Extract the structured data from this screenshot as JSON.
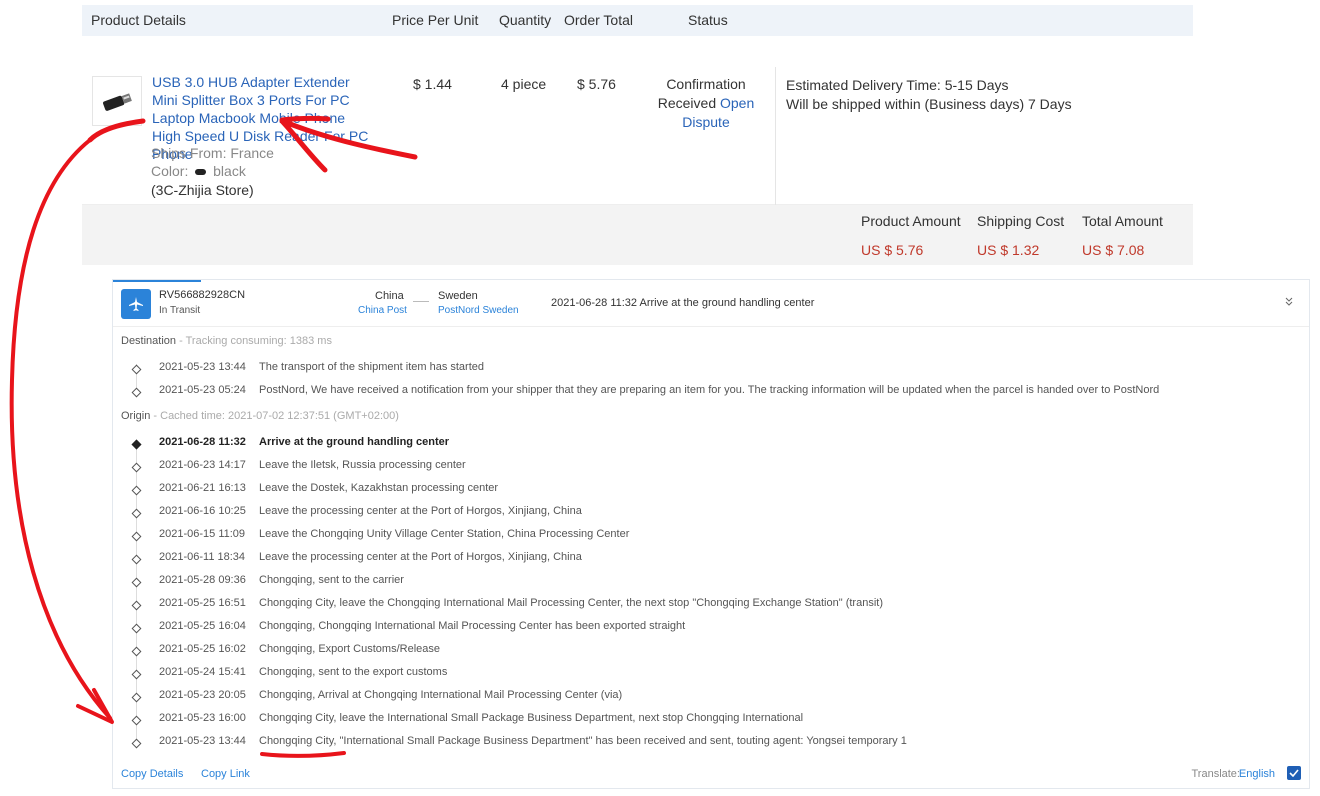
{
  "order": {
    "headers": {
      "product": "Product Details",
      "price": "Price Per Unit",
      "quantity": "Quantity",
      "total": "Order Total",
      "status": "Status"
    },
    "product": {
      "title": "USB 3.0 HUB Adapter Extender Mini Splitter Box 3 Ports For PC Laptop Macbook Mobile Phone High Speed U Disk Reader For PC Phone",
      "ships_from": "Ships From: France",
      "color_label": "Color:",
      "color_value": "black",
      "store": "(3C-Zhijia Store)",
      "icons": [
        "delivery-truck-icon",
        "card-icon"
      ]
    },
    "price": "$ 1.44",
    "quantity": "4 piece",
    "order_total": "$ 5.76",
    "status": {
      "text": "Confirmation Received",
      "link_open": "Open",
      "link_dispute": "Dispute"
    },
    "delivery": {
      "estimated": "Estimated Delivery Time:  5-15 Days",
      "ship_within": "Will be shipped within (Business days)  7 Days"
    },
    "totals": {
      "product_amount_label": "Product Amount",
      "product_amount": "US $ 5.76",
      "shipping_cost_label": "Shipping Cost",
      "shipping_cost": "US $ 1.32",
      "total_amount_label": "Total Amount",
      "total_amount": "US $ 7.08"
    }
  },
  "tracking": {
    "number": "RV566882928CN",
    "state": "In Transit",
    "origin_country": "China",
    "origin_carrier": "China Post",
    "dest_country": "Sweden",
    "dest_carrier": "PostNord Sweden",
    "latest": "2021-06-28 11:32  Arrive at the ground handling center",
    "collapse_icon": "collapse-chevrons-icon",
    "destination": {
      "label": "Destination",
      "note": " - Tracking consuming: 1383 ms",
      "events": [
        {
          "time": "2021-05-23 13:44",
          "desc": "The transport of the shipment item has started"
        },
        {
          "time": "2021-05-23 05:24",
          "desc": "PostNord, We have received a notification from your shipper that they are preparing an item for you. The tracking information will be updated when the parcel is handed over to PostNord"
        }
      ]
    },
    "origin": {
      "label": "Origin",
      "note": " - Cached time: 2021-07-02 12:37:51 (GMT+02:00)",
      "events": [
        {
          "time": "2021-06-28 11:32",
          "desc": "Arrive at the ground handling center"
        },
        {
          "time": "2021-06-23 14:17",
          "desc": "Leave the Iletsk, Russia processing center"
        },
        {
          "time": "2021-06-21 16:13",
          "desc": "Leave the Dostek, Kazakhstan processing center"
        },
        {
          "time": "2021-06-16 10:25",
          "desc": "Leave the processing center at the Port of Horgos, Xinjiang, China"
        },
        {
          "time": "2021-06-15 11:09",
          "desc": "Leave the Chongqing Unity Village Center Station, China Processing Center"
        },
        {
          "time": "2021-06-11 18:34",
          "desc": "Leave the processing center at the Port of Horgos, Xinjiang, China"
        },
        {
          "time": "2021-05-28 09:36",
          "desc": "Chongqing, sent to the carrier"
        },
        {
          "time": "2021-05-25 16:51",
          "desc": "Chongqing City, leave the Chongqing International Mail Processing Center, the next stop \"Chongqing Exchange Station\" (transit)"
        },
        {
          "time": "2021-05-25 16:04",
          "desc": "Chongqing, Chongqing International Mail Processing Center has been exported straight"
        },
        {
          "time": "2021-05-25 16:02",
          "desc": "Chongqing, Export Customs/Release"
        },
        {
          "time": "2021-05-24 15:41",
          "desc": "Chongqing, sent to the export customs"
        },
        {
          "time": "2021-05-23 20:05",
          "desc": "Chongqing, Arrival at Chongqing International Mail Processing Center (via)"
        },
        {
          "time": "2021-05-23 16:00",
          "desc": "Chongqing City, leave the International Small Package Business Department, next stop Chongqing International"
        },
        {
          "time": "2021-05-23 13:44",
          "desc": "Chongqing City, \"International Small Package Business Department\" has been received and sent, touting agent: Yongsei temporary 1"
        }
      ]
    },
    "footer": {
      "copy_details": "Copy Details",
      "copy_link": "Copy Link",
      "translate_label": "Translate:",
      "translate_lang": "English"
    }
  },
  "colors": {
    "link": "#2a64b8",
    "accent": "#2b83d9",
    "price_red": "#c0392b",
    "annotation": "#e8141b"
  }
}
